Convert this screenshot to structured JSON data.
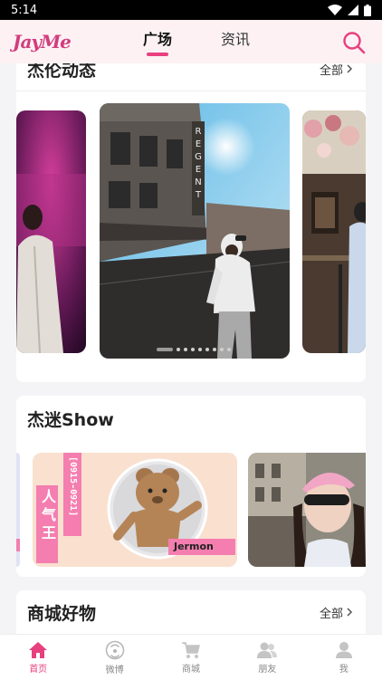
{
  "status_bar": {
    "time": "5:14"
  },
  "header": {
    "logo_text": "JayMe",
    "tabs": [
      {
        "label": "广场"
      },
      {
        "label": "资讯"
      }
    ],
    "active_tab": "广场"
  },
  "sections": {
    "jay_news": {
      "title": "杰伦动态",
      "see_all": "全部"
    },
    "fan_show": {
      "title": "杰迷Show"
    },
    "mall": {
      "title": "商城好物",
      "see_all": "全部"
    }
  },
  "carousel": {
    "slide_count": 9,
    "active_index": 0,
    "regent_sign": "REGENT"
  },
  "fan_show_card": {
    "date_range": "[0915-0921]",
    "badge": "人气王",
    "name_tag": "Jermon"
  },
  "bottom_nav": [
    {
      "label": "首页",
      "icon": "home-icon"
    },
    {
      "label": "微博",
      "icon": "weibo-icon"
    },
    {
      "label": "商城",
      "icon": "cart-icon"
    },
    {
      "label": "朋友",
      "icon": "friends-icon"
    },
    {
      "label": "我",
      "icon": "person-icon"
    }
  ],
  "colors": {
    "accent": "#e8407e",
    "header_bg": "#fdf1f4",
    "page_bg": "#f4f4f6"
  }
}
